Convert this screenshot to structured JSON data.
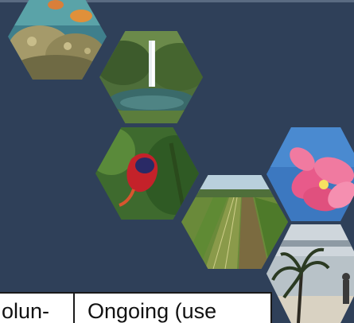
{
  "hex_images": [
    {
      "name": "coral-reef-photo"
    },
    {
      "name": "waterfall-photo"
    },
    {
      "name": "red-bird-photo"
    },
    {
      "name": "farmland-photo"
    },
    {
      "name": "pink-flower-photo"
    },
    {
      "name": "beach-palm-photo"
    }
  ],
  "table": {
    "cells": [
      "olun-",
      "Ongoing (use"
    ]
  },
  "colors": {
    "background": "#2f4059",
    "cell_background": "#ffffff",
    "cell_border": "#1a1a1a"
  }
}
